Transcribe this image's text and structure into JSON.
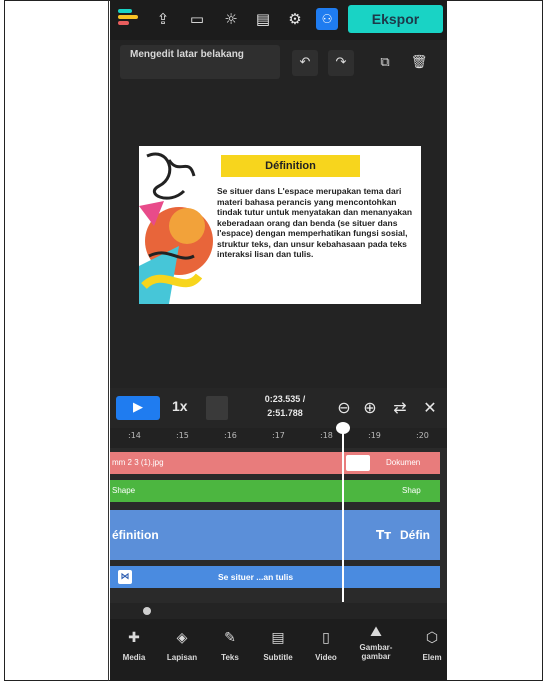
{
  "topbar": {
    "logo_icon": "app-logo-icon",
    "icons": [
      "upload-icon",
      "subtitles-icon",
      "brightness-icon",
      "caption-icon",
      "settings-icon"
    ],
    "people_icon": "people-icon",
    "export_label": "Ekspor",
    "export_color": "#19d3c5"
  },
  "editbar": {
    "status_text": "Mengedit latar belakang",
    "undo_icon": "undo-icon",
    "redo_icon": "redo-icon",
    "duplicate_icon": "duplicate-icon",
    "delete_icon": "delete-icon"
  },
  "slide": {
    "title": "Définition",
    "body": "Se situer dans L'espace merupakan tema dari materi bahasa perancis yang mencontohkan tindak tutur untuk menyatakan dan menanyakan keberadaan orang dan benda (se situer dans l'espace) dengan memperhatikan fungsi sosial, struktur teks, dan unsur kebahasaan pada teks interaksi lisan dan tulis.",
    "title_bg": "#f7d51d"
  },
  "timeline": {
    "play_icon": "play-icon",
    "speed": "1x",
    "time_current": "0:23.535 /",
    "time_total": "2:51.788",
    "zoom_out_icon": "zoom-out-icon",
    "zoom_in_icon": "zoom-in-icon",
    "collapse_icon": "collapse-icon",
    "close_icon": "close-icon",
    "ruler_ticks": [
      ":14",
      ":15",
      ":16",
      ":17",
      ":18",
      ":19",
      ":20"
    ]
  },
  "tracks": {
    "image_left": "mm 2 3 (1).jpg",
    "image_right": "Dokumen",
    "shape_left": "Shape",
    "shape_right": "Shap",
    "text_left": "éfinition",
    "text_right": "Défin",
    "text_icon": "text-icon",
    "audio_label": "Se situer ...an tulis",
    "transition_icon": "transition-icon"
  },
  "bottombar": {
    "items": [
      {
        "label": "Media",
        "icon": "media-icon"
      },
      {
        "label": "Lapisan",
        "icon": "layers-icon"
      },
      {
        "label": "Teks",
        "icon": "text-edit-icon"
      },
      {
        "label": "Subtitle",
        "icon": "subtitle-icon"
      },
      {
        "label": "Video",
        "icon": "video-icon"
      },
      {
        "label": "Gambar-gambar",
        "icon": "image-icon"
      },
      {
        "label": "Elem",
        "icon": "elements-icon"
      }
    ]
  }
}
